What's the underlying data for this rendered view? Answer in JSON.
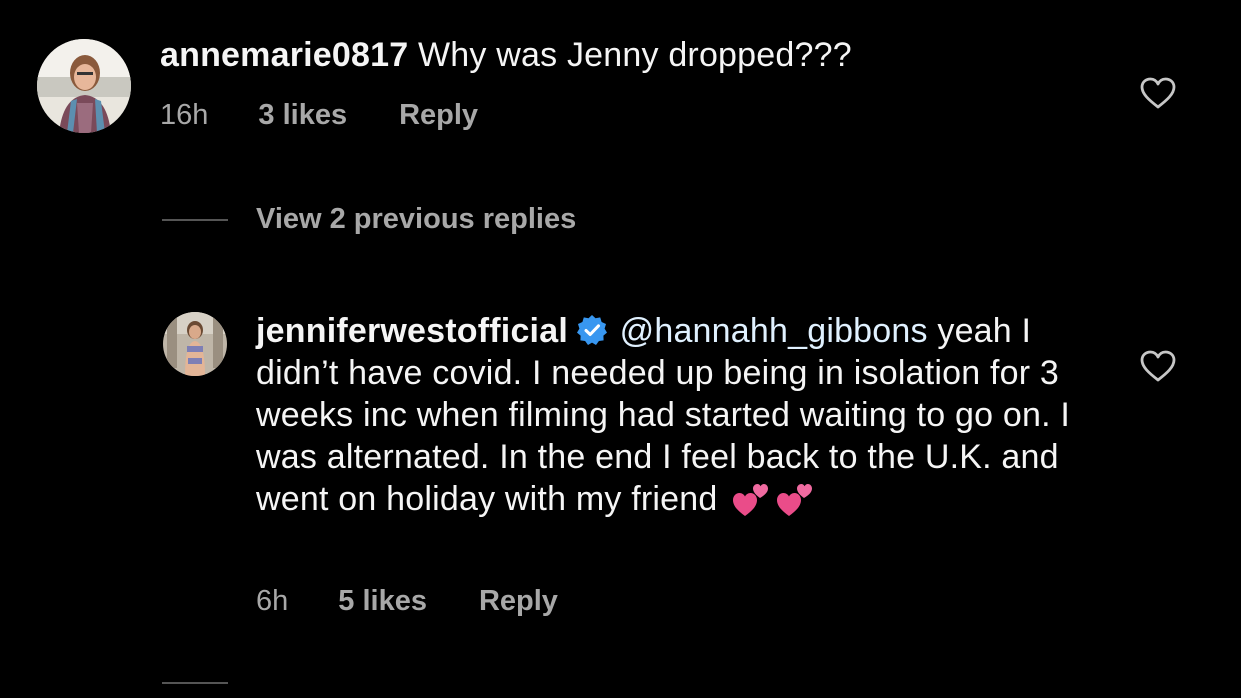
{
  "comments": [
    {
      "username": "annemarie0817",
      "text": "Why was Jenny dropped???",
      "time": "16h",
      "likes": "3 likes",
      "reply_label": "Reply"
    },
    {
      "username": "jenniferwestofficial",
      "verified": true,
      "mention": "@hannahh_gibbons",
      "text": "yeah I didn’t have covid. I needed up being in isolation for 3 weeks inc when filming had started waiting to go on. I was alternated. In the end I feel back to the U.K. and went on holiday with my friend",
      "emojis": [
        "two-hearts-emoji",
        "two-hearts-emoji"
      ],
      "time": "6h",
      "likes": "5 likes",
      "reply_label": "Reply"
    }
  ],
  "view_replies": {
    "label": "View 2 previous replies"
  },
  "colors": {
    "background": "#000000",
    "text": "#f5f5f5",
    "secondary": "#a8a8a8",
    "verified_blue": "#3897f0"
  }
}
